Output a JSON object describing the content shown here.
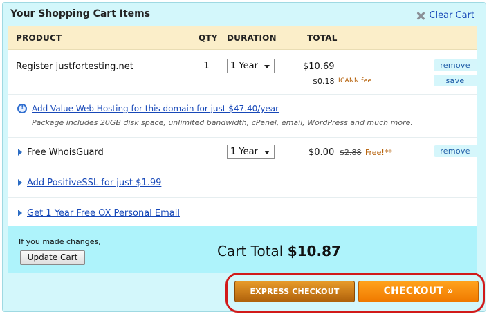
{
  "panel": {
    "title": "Your Shopping Cart Items",
    "clear_cart": "Clear Cart"
  },
  "headers": {
    "product": "PRODUCT",
    "qty": "QTY",
    "duration": "DURATION",
    "total": "TOTAL"
  },
  "rows": {
    "domain": {
      "product": "Register justfortesting.net",
      "qty": "1",
      "duration": "1 Year",
      "total": "$10.69",
      "fee_amount": "$0.18",
      "fee_label": "ICANN fee",
      "remove": "remove",
      "save": "save"
    },
    "hosting_offer": {
      "link": "Add Value Web Hosting for this domain for just $47.40/year",
      "description": "Package includes 20GB disk space, unlimited bandwidth, cPanel, email, WordPress and much more."
    },
    "whoisguard": {
      "product": "Free WhoisGuard",
      "duration": "1 Year",
      "total": "$0.00",
      "old_price": "$2.88",
      "free_label": "Free!**",
      "remove": "remove"
    },
    "ssl_offer": {
      "link": "Add PositiveSSL for just $1.99"
    },
    "email_offer": {
      "link": "Get 1 Year Free OX Personal Email"
    }
  },
  "totals": {
    "changes_label": "If you made changes,",
    "update_button": "Update Cart",
    "cart_total_label": "Cart Total",
    "cart_total_value": "$10.87"
  },
  "checkout": {
    "express": "EXPRESS CHECKOUT",
    "checkout": "CHECKOUT »"
  },
  "colors": {
    "panel_bg": "#d3f7fb",
    "header_bg": "#fbeec9",
    "total_bar_bg": "#aef3fb",
    "link": "#1748b8",
    "highlight": "#d11a1a",
    "checkout_orange": "#f07a00"
  }
}
